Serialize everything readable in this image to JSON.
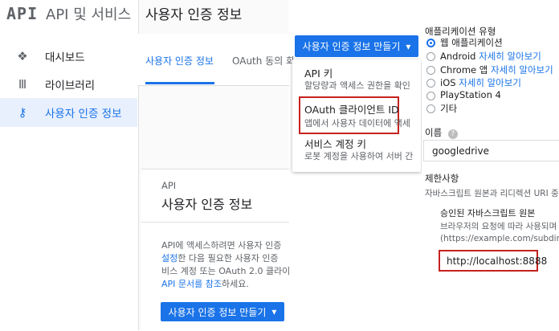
{
  "sidebar": {
    "logo": "API",
    "title": "API 및 서비스",
    "items": [
      {
        "label": "대시보드",
        "icon": "dashboard-icon",
        "glyph": "❖"
      },
      {
        "label": "라이브러리",
        "icon": "library-icon",
        "glyph": "Ⅲ"
      },
      {
        "label": "사용자 인증 정보",
        "icon": "key-icon",
        "glyph": "⚷"
      }
    ]
  },
  "header": {
    "title": "사용자 인증 정보"
  },
  "tabs": [
    "사용자 인증 정보",
    "OAuth 동의 화"
  ],
  "create_button": {
    "label": "사용자 인증 정보 만들기",
    "caret": "▾"
  },
  "card": {
    "sub": "API",
    "title": "사용자 인증 정보",
    "line1": "API에 액세스하려면 사용자 인증",
    "line2_link": "설정",
    "line2_rest": "한 다음 필요한 사용자 인증",
    "line3": "비스 계정 또는 OAuth 2.0 클라이",
    "line4_link": "API 문서를 참조",
    "line4_rest": "하세요.",
    "button_label": "사용자 인증 정보 만들기"
  },
  "menu": [
    {
      "title": "API 키",
      "desc": "할당량과 액세스 권한을 확인"
    },
    {
      "title": "OAuth 클라이언트 ID",
      "desc": "앱에서 사용자 데이터에 액세"
    },
    {
      "title": "서비스 계정 키",
      "desc": "로봇 계정을 사용하여 서버 간"
    }
  ],
  "app_type": {
    "label": "애플리케이션 유형",
    "options": [
      {
        "label": "웹 애플리케이션",
        "link": "",
        "selected": true
      },
      {
        "label": "Android",
        "link": "자세히 알아보기",
        "selected": false
      },
      {
        "label": "Chrome 앱",
        "link": "자세히 알아보기",
        "selected": false
      },
      {
        "label": "iOS",
        "link": "자세히 알아보기",
        "selected": false
      },
      {
        "label": "PlayStation 4",
        "link": "",
        "selected": false
      },
      {
        "label": "기타",
        "link": "",
        "selected": false
      }
    ]
  },
  "name_field": {
    "label": "이름",
    "help": "?",
    "value": "googledrive"
  },
  "restrictions": {
    "label": "제한사항",
    "desc": "자바스크립트 원본과 리디렉션 URI 중",
    "origins_label": "승인된 자바스크립트 원본",
    "origins_desc": "브라우저의 요청에 따라 사용되며",
    "origins_hint": "(https://example.com/subdir",
    "origin_value": "http://localhost:8888"
  },
  "colors": {
    "accent": "#1a73e8",
    "highlight": "#c5221f"
  }
}
